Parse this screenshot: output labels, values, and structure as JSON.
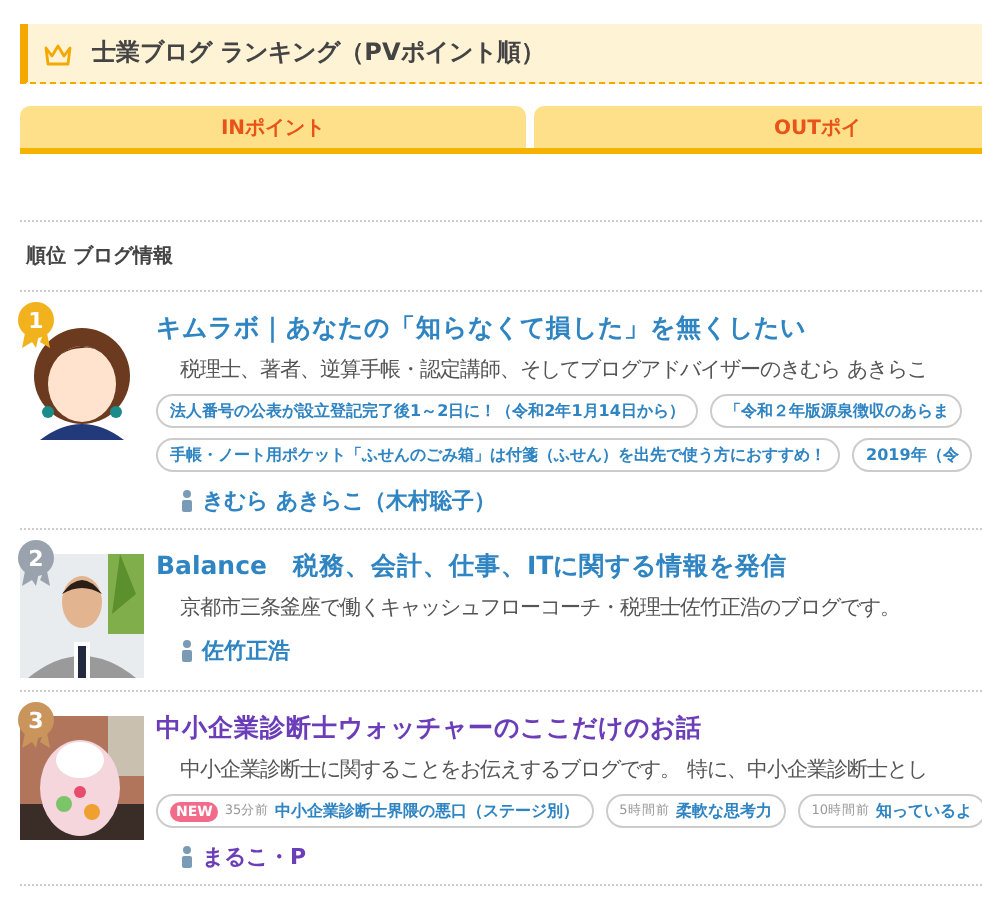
{
  "header": {
    "title": "士業ブログ ランキング（PVポイント順）"
  },
  "tabs": [
    {
      "label": "INポイント",
      "selected": false
    },
    {
      "label": "OUTポイ",
      "selected": false
    }
  ],
  "list_header": "順位 ブログ情報",
  "entries": [
    {
      "rank": "1",
      "color": "#f2b21e",
      "visited": false,
      "title": "キムラボ｜あなたの「知らなくて損した」を無くしたい",
      "description": "税理士、著者、逆算手帳・認定講師、そしてブログアドバイザーのきむら あきらこ",
      "tag_rows": [
        [
          {
            "text": "法人番号の公表が設立登記完了後1～2日に！（令和2年1月14日から）",
            "new": false
          },
          {
            "text": "「令和２年版源泉徴収のあらま",
            "new": false
          }
        ],
        [
          {
            "text": "手帳・ノート用ポケット「ふせんのごみ箱」は付箋（ふせん）を出先で使う方におすすめ！",
            "new": false
          },
          {
            "text": "2019年（令",
            "new": false
          }
        ]
      ],
      "author": "きむら あきらこ（木村聡子）"
    },
    {
      "rank": "2",
      "color": "#9aa3ad",
      "visited": false,
      "title": "Balance　税務、会計、仕事、ITに関する情報を発信",
      "description": "京都市三条釜座で働くキャッシュフローコーチ・税理士佐竹正浩のブログです。",
      "author": "佐竹正浩"
    },
    {
      "rank": "3",
      "color": "#c9955c",
      "visited": true,
      "title": "中小企業診断士ウォッチャーのここだけのお話",
      "description": "中小企業診断士に関することをお伝えするブログです。 特に、中小企業診断士とし",
      "tag_rows": [
        [
          {
            "new": true,
            "badge": "NEW",
            "time": "35分前",
            "text": "中小企業診断士界隈の悪口（ステージ別）"
          },
          {
            "new": false,
            "time": "5時間前",
            "text": "柔軟な思考力"
          },
          {
            "new": false,
            "time": "10時間前",
            "text": "知っているよ"
          }
        ]
      ],
      "author": "まるこ・P"
    }
  ]
}
